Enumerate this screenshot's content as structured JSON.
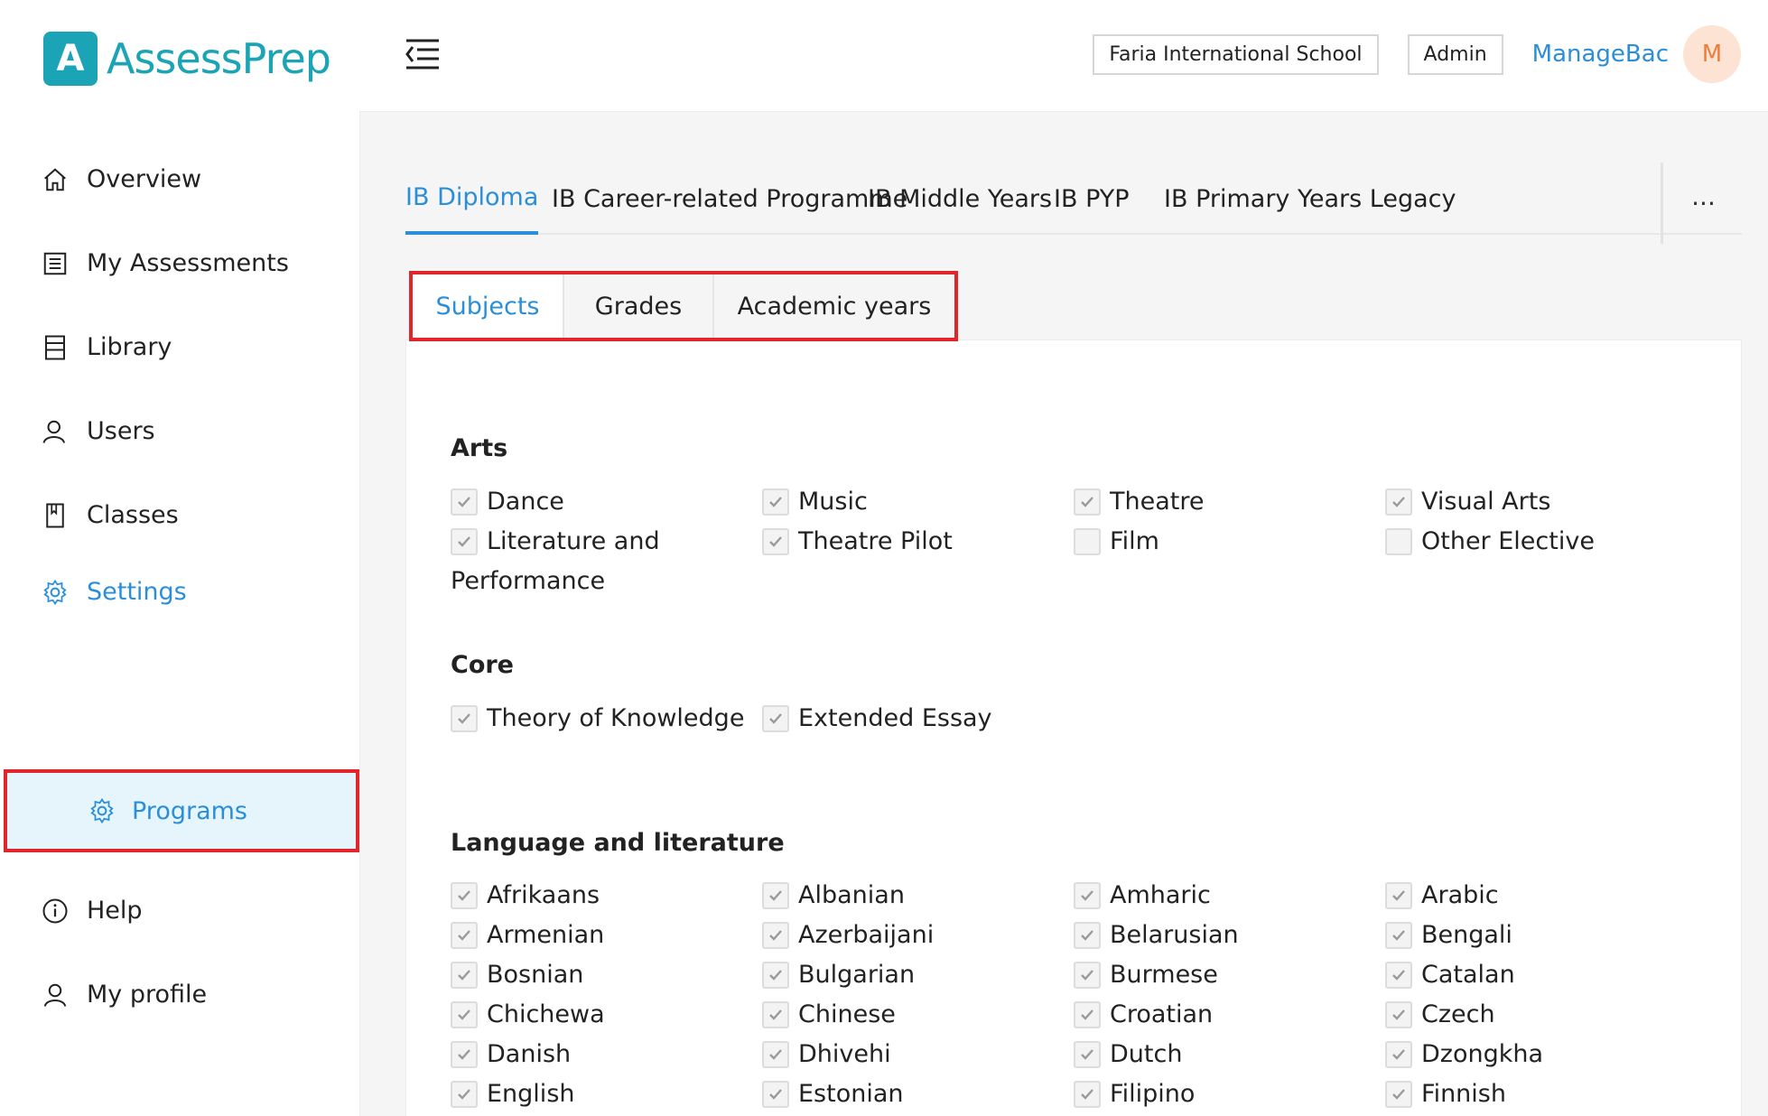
{
  "app": {
    "name": "AssessPrep",
    "logo_letter": "A"
  },
  "header": {
    "school": "Faria International School",
    "role": "Admin",
    "link": "ManageBac",
    "avatar_initial": "M"
  },
  "sidebar": {
    "items": [
      {
        "label": "Overview"
      },
      {
        "label": "My Assessments"
      },
      {
        "label": "Library"
      },
      {
        "label": "Users"
      },
      {
        "label": "Classes"
      },
      {
        "label": "Settings"
      },
      {
        "label": "Help"
      },
      {
        "label": "My profile"
      }
    ],
    "sub_item": {
      "label": "Programs"
    }
  },
  "program_tabs": [
    "IB Diploma",
    "IB Career-related Programme",
    "IB Middle Years",
    "IB PYP",
    "IB Primary Years Legacy"
  ],
  "more_label": "···",
  "sub_tabs": [
    "Subjects",
    "Grades",
    "Academic years"
  ],
  "sections": {
    "arts": {
      "title": "Arts",
      "items": [
        {
          "label": "Dance",
          "checked": true
        },
        {
          "label": "Music",
          "checked": true
        },
        {
          "label": "Theatre",
          "checked": true
        },
        {
          "label": "Visual Arts",
          "checked": true
        },
        {
          "label": "Literature and Performance",
          "checked": true
        },
        {
          "label": "Theatre Pilot",
          "checked": true
        },
        {
          "label": "Film",
          "checked": false
        },
        {
          "label": "Other Elective",
          "checked": false
        }
      ]
    },
    "core": {
      "title": "Core",
      "items": [
        {
          "label": "Theory of Knowledge",
          "checked": true
        },
        {
          "label": "Extended Essay",
          "checked": true
        }
      ]
    },
    "language": {
      "title": "Language and literature",
      "items": [
        {
          "label": "Afrikaans",
          "checked": true
        },
        {
          "label": "Albanian",
          "checked": true
        },
        {
          "label": "Amharic",
          "checked": true
        },
        {
          "label": "Arabic",
          "checked": true
        },
        {
          "label": "Armenian",
          "checked": true
        },
        {
          "label": "Azerbaijani",
          "checked": true
        },
        {
          "label": "Belarusian",
          "checked": true
        },
        {
          "label": "Bengali",
          "checked": true
        },
        {
          "label": "Bosnian",
          "checked": true
        },
        {
          "label": "Bulgarian",
          "checked": true
        },
        {
          "label": "Burmese",
          "checked": true
        },
        {
          "label": "Catalan",
          "checked": true
        },
        {
          "label": "Chichewa",
          "checked": true
        },
        {
          "label": "Chinese",
          "checked": true
        },
        {
          "label": "Croatian",
          "checked": true
        },
        {
          "label": "Czech",
          "checked": true
        },
        {
          "label": "Danish",
          "checked": true
        },
        {
          "label": "Dhivehi",
          "checked": true
        },
        {
          "label": "Dutch",
          "checked": true
        },
        {
          "label": "Dzongkha",
          "checked": true
        },
        {
          "label": "English",
          "checked": true
        },
        {
          "label": "Estonian",
          "checked": true
        },
        {
          "label": "Filipino",
          "checked": true
        },
        {
          "label": "Finnish",
          "checked": true
        }
      ]
    }
  },
  "colors": {
    "accent": "#2a8fd8",
    "brand": "#1ba4b5",
    "highlight": "#e0262b"
  }
}
